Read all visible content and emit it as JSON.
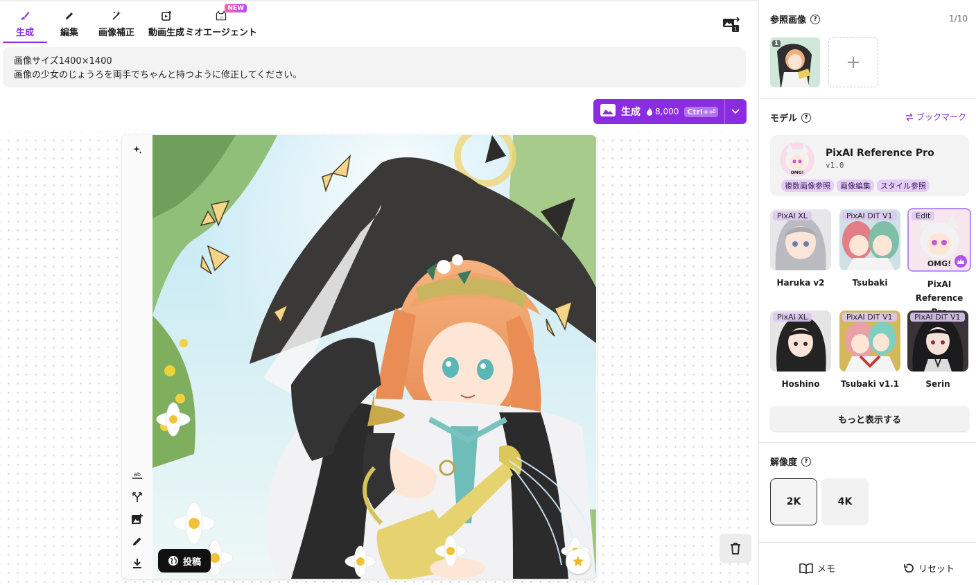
{
  "tabs": [
    {
      "label": "生成",
      "icon": "brush-icon",
      "active": true
    },
    {
      "label": "編集",
      "icon": "pencil-icon"
    },
    {
      "label": "画像補正",
      "icon": "magic-wand-icon"
    },
    {
      "label": "動画生成",
      "icon": "video-add-icon"
    },
    {
      "label": "ミオエージェント",
      "icon": "cat-agent-icon",
      "badge": "NEW"
    }
  ],
  "prompt": {
    "line1": "画像サイズ1400×1400",
    "line2": "画像の少女のじょうろを両手でちゃんと持つように修正してください。"
  },
  "generate_button": {
    "label": "生成",
    "cost": "8,000",
    "shortcut": "Ctrl+⏎"
  },
  "post_button": {
    "label": "投稿"
  },
  "panel": {
    "reference": {
      "title": "参照画像",
      "count": "1/10",
      "thumb_number": "1"
    },
    "model": {
      "title": "モデル",
      "bookmark": "ブックマーク",
      "selected": {
        "name": "PixAI Reference Pro",
        "version": "v1.0",
        "tags": [
          "複数画像参照",
          "画像編集",
          "スタイル参照"
        ]
      },
      "list": [
        {
          "name": "Haruka v2",
          "badge": "PixAI XL"
        },
        {
          "name": "Tsubaki",
          "badge": "PixAI DiT V1"
        },
        {
          "name": "PixAI Reference Pro",
          "badge": "Edit",
          "selected": true
        },
        {
          "name": "Hoshino",
          "badge": "PixAI XL"
        },
        {
          "name": "Tsubaki v1.1",
          "badge": "PixAI DiT V1"
        },
        {
          "name": "Serin",
          "badge": "PixAI DiT V1"
        }
      ],
      "more": "もっと表示する"
    },
    "resolution": {
      "title": "解像度",
      "options": [
        "2K",
        "4K"
      ],
      "selected": "2K"
    },
    "footer": {
      "memo": "メモ",
      "reset": "リセット"
    }
  },
  "colors": {
    "accent": "#8b2be2"
  }
}
